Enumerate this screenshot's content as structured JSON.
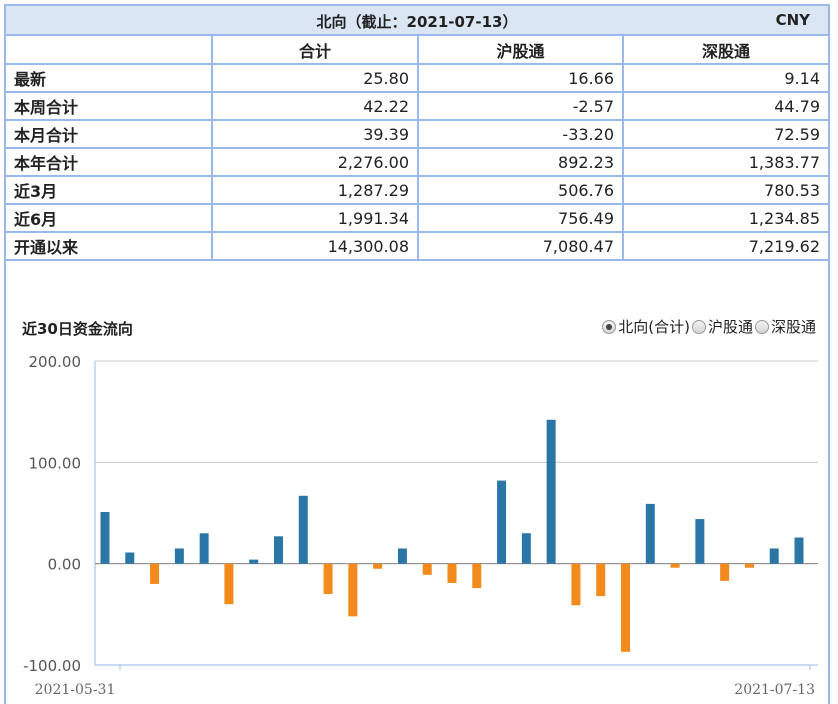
{
  "header": {
    "title": "北向（截止：2021-07-13）",
    "currency": "CNY"
  },
  "table": {
    "columns": [
      "",
      "合计",
      "沪股通",
      "深股通"
    ],
    "rows": [
      {
        "label": "最新",
        "values": [
          "25.80",
          "16.66",
          "9.14"
        ]
      },
      {
        "label": "本周合计",
        "values": [
          "42.22",
          "-2.57",
          "44.79"
        ]
      },
      {
        "label": "本月合计",
        "values": [
          "39.39",
          "-33.20",
          "72.59"
        ]
      },
      {
        "label": "本年合计",
        "values": [
          "2,276.00",
          "892.23",
          "1,383.77"
        ]
      },
      {
        "label": "近3月",
        "values": [
          "1,287.29",
          "506.76",
          "780.53"
        ]
      },
      {
        "label": "近6月",
        "values": [
          "1,991.34",
          "756.49",
          "1,234.85"
        ]
      },
      {
        "label": "开通以来",
        "values": [
          "14,300.08",
          "7,080.47",
          "7,219.62"
        ]
      }
    ]
  },
  "chart_section": {
    "title": "近30日资金流向",
    "options": [
      {
        "label": "北向(合计)",
        "selected": true
      },
      {
        "label": "沪股通",
        "selected": false
      },
      {
        "label": "深股通",
        "selected": false
      }
    ]
  },
  "chart_data": {
    "type": "bar",
    "title": "",
    "xlabel": "",
    "ylabel": "",
    "ylim": [
      -100,
      200
    ],
    "y_ticks": [
      "200.00",
      "100.00",
      "0.00",
      "-100.00"
    ],
    "y_tick_values": [
      200,
      100,
      0,
      -100
    ],
    "x_tick_labels": [
      "2021-05-31",
      "2021-07-13"
    ],
    "grid": true,
    "values": [
      51,
      11,
      -20,
      15,
      30,
      -40,
      4,
      27,
      67,
      -30,
      -52,
      -5,
      15,
      -11,
      -19,
      -24,
      82,
      30,
      142,
      -41,
      -32,
      -87,
      59,
      -4,
      44,
      -17,
      -4,
      15,
      25.8
    ],
    "positive_color": "#2a77a7",
    "negative_color": "#f28a1c"
  }
}
